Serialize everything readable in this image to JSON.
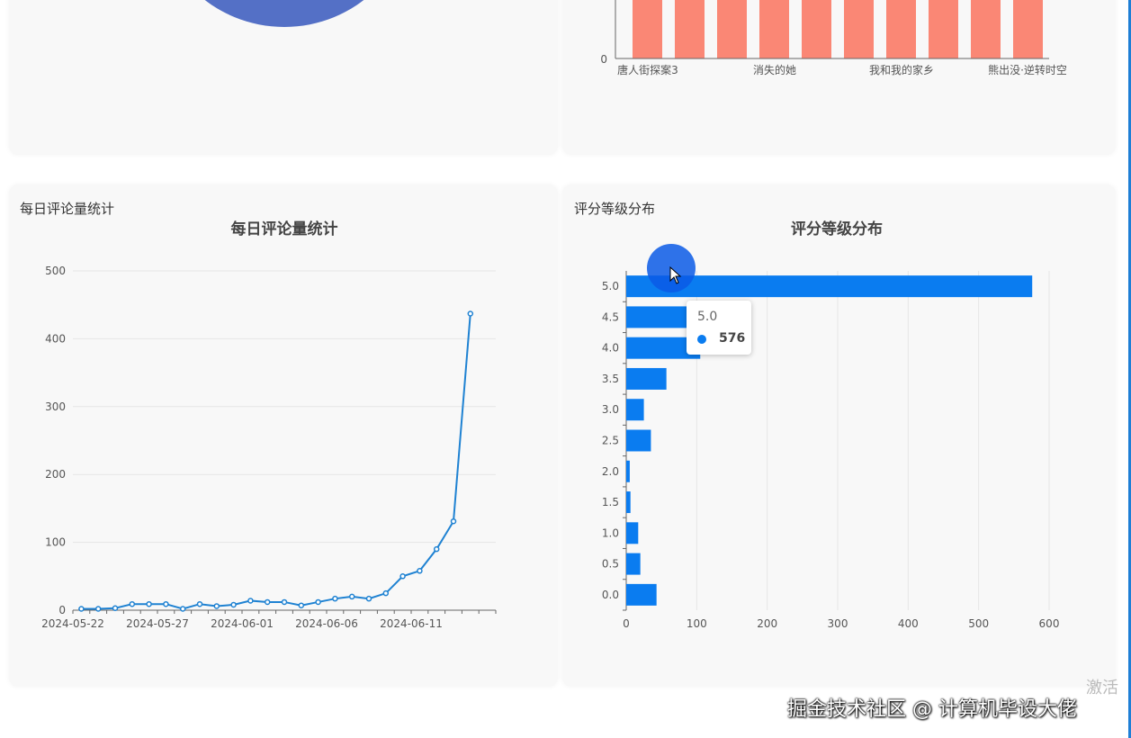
{
  "top_bar_chart": {
    "y_zero_label": "0",
    "categories": [
      "唐人街探案3",
      "消失的她",
      "我和我的家乡",
      "熊出没·逆转时空"
    ],
    "bar_color": "#fa8775"
  },
  "pie_color": "#5470c6",
  "line_card": {
    "heading": "每日评论量统计"
  },
  "bar_card": {
    "heading": "评分等级分布"
  },
  "tooltip": {
    "category": "5.0",
    "value": "576"
  },
  "watermark": "掘金技术社区 @ 计算机毕设大佬",
  "activate_text": "激活",
  "chart_data": [
    {
      "type": "line",
      "title": "每日评论量统计",
      "color": "#1f82d2",
      "x": [
        "2024-05-22",
        "2024-05-23",
        "2024-05-24",
        "2024-05-25",
        "2024-05-26",
        "2024-05-27",
        "2024-05-28",
        "2024-05-29",
        "2024-05-30",
        "2024-05-31",
        "2024-06-01",
        "2024-06-02",
        "2024-06-03",
        "2024-06-04",
        "2024-06-05",
        "2024-06-06",
        "2024-06-07",
        "2024-06-08",
        "2024-06-09",
        "2024-06-10",
        "2024-06-11",
        "2024-06-12",
        "2024-06-13",
        "2024-06-14",
        "2024-06-15"
      ],
      "values": [
        2,
        2,
        3,
        9,
        9,
        9,
        2,
        9,
        6,
        8,
        14,
        12,
        12,
        7,
        12,
        17,
        20,
        17,
        25,
        50,
        58,
        90,
        131,
        437
      ],
      "xticks": [
        "2024-05-22",
        "2024-05-27",
        "2024-06-01",
        "2024-06-06",
        "2024-06-11"
      ],
      "yticks": [
        "0",
        "100",
        "200",
        "300",
        "400",
        "500"
      ],
      "ylim": [
        0,
        500
      ],
      "grid": true
    },
    {
      "type": "bar",
      "orientation": "horizontal",
      "title": "评分等级分布",
      "color": "#0a7cf0",
      "categories": [
        "0.0",
        "0.5",
        "1.0",
        "1.5",
        "2.0",
        "2.5",
        "3.0",
        "3.5",
        "4.0",
        "4.5",
        "5.0"
      ],
      "values": [
        43,
        20,
        17,
        6,
        5,
        35,
        25,
        57,
        105,
        88,
        576
      ],
      "xticks": [
        "0",
        "100",
        "200",
        "300",
        "400",
        "500",
        "600"
      ],
      "xlim": [
        0,
        600
      ],
      "grid": true
    }
  ]
}
